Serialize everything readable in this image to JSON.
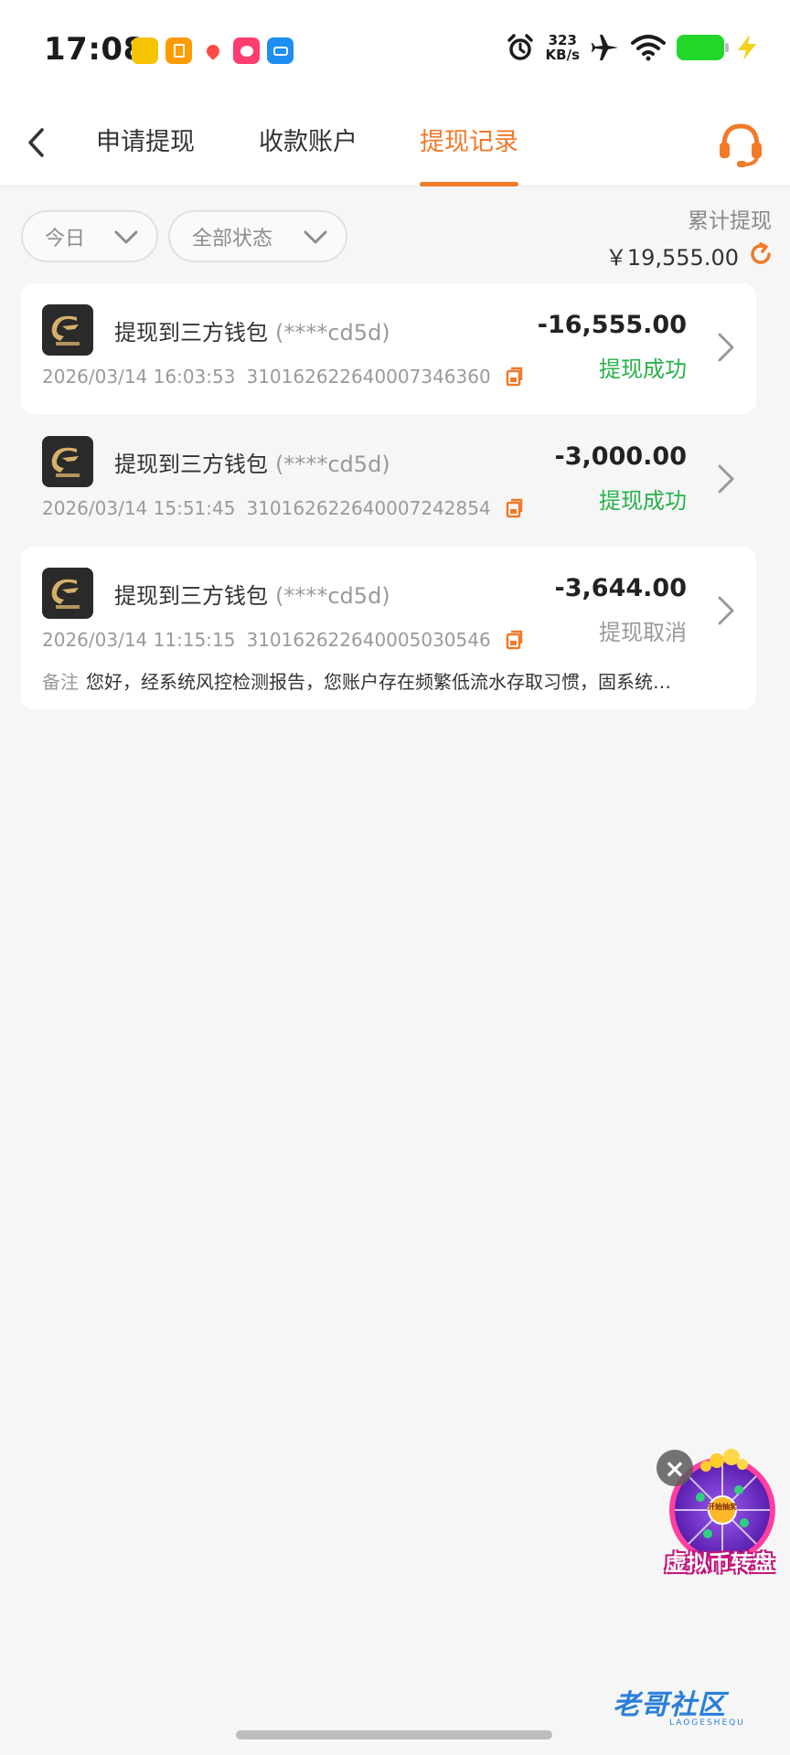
{
  "status_bar": {
    "time": "17:08",
    "net_speed_value": "323",
    "net_speed_unit": "KB/s",
    "apps": [
      {
        "icon": "gold-app-icon",
        "color": "#f5c400"
      },
      {
        "icon": "orange-app-icon",
        "color": "#ff9c00"
      },
      {
        "icon": "map-app-icon",
        "color": "#ff4a4a"
      },
      {
        "icon": "pink-app-icon",
        "color": "#ff3d6e"
      },
      {
        "icon": "blue-app-icon",
        "color": "#1e8ff0"
      }
    ]
  },
  "tabs": [
    {
      "label": "申请提现",
      "active": false
    },
    {
      "label": "收款账户",
      "active": false
    },
    {
      "label": "提现记录",
      "active": true
    }
  ],
  "filters": {
    "date": "今日",
    "status": "全部状态"
  },
  "summary": {
    "label": "累计提现",
    "value": "￥19,555.00"
  },
  "records": [
    {
      "title": "提现到三方钱包",
      "account": "(****cd5d)",
      "datetime": "2026/03/14 16:03:53",
      "order_no": "310162622640007346360",
      "amount": "-16,555.00",
      "status": "提现成功",
      "status_color": "#27b24a"
    },
    {
      "title": "提现到三方钱包",
      "account": "(****cd5d)",
      "datetime": "2026/03/14 15:51:45",
      "order_no": "310162622640007242854",
      "amount": "-3,000.00",
      "status": "提现成功",
      "status_color": "#27b24a"
    },
    {
      "title": "提现到三方钱包",
      "account": "(****cd5d)",
      "datetime": "2026/03/14 11:15:15",
      "order_no": "310162622640005030546",
      "amount": "-3,644.00",
      "status": "提现取消",
      "status_color": "#9a9a9a",
      "remark_label": "备注",
      "remark": "您好，经系统风控检测报告，您账户存在频繁低流水存取习惯，固系统…"
    }
  ],
  "promo": {
    "label": "虚拟币转盘",
    "center_text": "开始抽奖"
  },
  "watermark": {
    "text": "老哥社区",
    "sub": "LAOGESHEQU"
  },
  "theme": {
    "accent": "#f07a28",
    "success": "#27b24a"
  }
}
